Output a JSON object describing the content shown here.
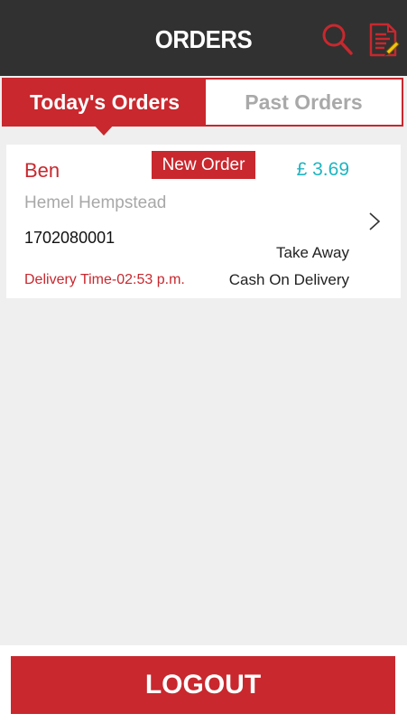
{
  "header": {
    "title": "ORDERS",
    "search_icon": "search-icon",
    "report_icon": "report-document-icon"
  },
  "tabs": [
    {
      "label": "Today's Orders",
      "active": true
    },
    {
      "label": "Past Orders",
      "active": false
    }
  ],
  "orders": [
    {
      "customer": "Ben",
      "badge": "New Order",
      "price": "£ 3.69",
      "location": "Hemel Hempstead",
      "order_number": "1702080001",
      "service_type": "Take Away",
      "delivery_time": "Delivery Time-02:53 p.m.",
      "payment": "Cash On Delivery"
    }
  ],
  "footer": {
    "logout_label": "LOGOUT"
  },
  "colors": {
    "accent": "#c8282e",
    "price": "#1fb5c0",
    "header_bg": "#313131",
    "background": "#efefef"
  }
}
